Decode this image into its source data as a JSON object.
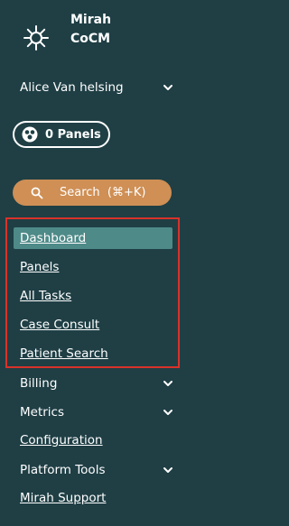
{
  "brand": {
    "line1": "Mirah",
    "line2": "CoCM"
  },
  "user": {
    "name": "Alice Van helsing"
  },
  "panels_button": {
    "label": "0 Panels"
  },
  "search": {
    "label": "Search  (⌘+K)"
  },
  "nav": {
    "dashboard": "Dashboard",
    "panels": "Panels",
    "all_tasks": "All Tasks",
    "case_consult": "Case Consult",
    "patient_search": "Patient Search",
    "billing": "Billing",
    "metrics": "Metrics",
    "configuration": "Configuration",
    "platform_tools": "Platform Tools",
    "mirah_support": "Mirah Support"
  },
  "colors": {
    "background": "#1f3f45",
    "active_item": "#4e8a88",
    "search_button": "#cf8f55",
    "highlight_outline": "#d9322a"
  },
  "icons": {
    "logo": "mirah-star-icon",
    "user_chevron": "chevron-down-icon",
    "panels": "panels-icon",
    "search": "search-icon"
  }
}
